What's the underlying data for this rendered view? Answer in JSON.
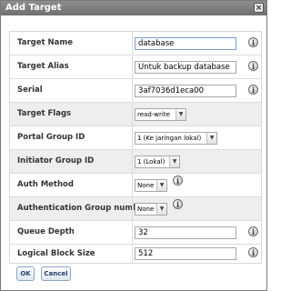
{
  "dialog": {
    "title": "Add Target",
    "close_glyph": "×"
  },
  "fields": {
    "target_name": {
      "label": "Target Name",
      "value": "database"
    },
    "target_alias": {
      "label": "Target Alias",
      "value": "Untuk backup database"
    },
    "serial": {
      "label": "Serial",
      "value": "3af7036d1eca00"
    },
    "target_flags": {
      "label": "Target Flags",
      "value": "read-write"
    },
    "portal_group_id": {
      "label": "Portal Group ID",
      "value": "1 (Ke jaringan lokal)"
    },
    "initiator_group_id": {
      "label": "Initiator Group ID",
      "value": "1 (Lokal)"
    },
    "auth_method": {
      "label": "Auth Method",
      "value": "None"
    },
    "auth_group_number": {
      "label": "Authentication Group number",
      "value": "None"
    },
    "queue_depth": {
      "label": "Queue Depth",
      "value": "32"
    },
    "logical_block_size": {
      "label": "Logical Block Size",
      "value": "512"
    }
  },
  "icons": {
    "info_glyph": "i",
    "dropdown_glyph": "▼"
  },
  "buttons": {
    "ok_label": "OK",
    "cancel_label": "Cancel"
  }
}
